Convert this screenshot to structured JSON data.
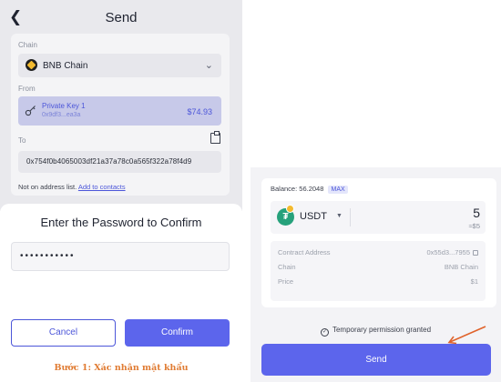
{
  "send_screen": {
    "back_icon": "chevron-left-icon",
    "title": "Send",
    "chain_label": "Chain",
    "chain_value": "BNB Chain",
    "from_label": "From",
    "from_name": "Private Key 1",
    "from_address": "0x9df3...ea3a",
    "from_balance": "$74.93",
    "to_label": "To",
    "to_address": "0x754f0b4065003df21a37a78c0a565f322a78f4d9",
    "address_note": "Not on address list.",
    "add_contacts": "Add to contacts"
  },
  "password_sheet": {
    "title": "Enter the Password to Confirm",
    "password_masked": "•••••••••••",
    "cancel": "Cancel",
    "confirm": "Confirm"
  },
  "caption": "Bước 1: Xác nhận mật khẩu",
  "send_confirm": {
    "balance_label": "Balance: 56.2048",
    "max": "MAX",
    "token": "USDT",
    "amount": "5",
    "amount_usd": "≈$5",
    "details": [
      {
        "key": "Contract Address",
        "value": "0x55d3...7955"
      },
      {
        "key": "Chain",
        "value": "BNB Chain"
      },
      {
        "key": "Price",
        "value": "$1"
      }
    ],
    "permission_text": "Temporary permission granted",
    "send_button": "Send"
  },
  "colors": {
    "accent": "#5c65ec",
    "from_highlight": "#c7c9e9",
    "caption": "#e07b32",
    "annotation_arrow": "#e0622a"
  }
}
